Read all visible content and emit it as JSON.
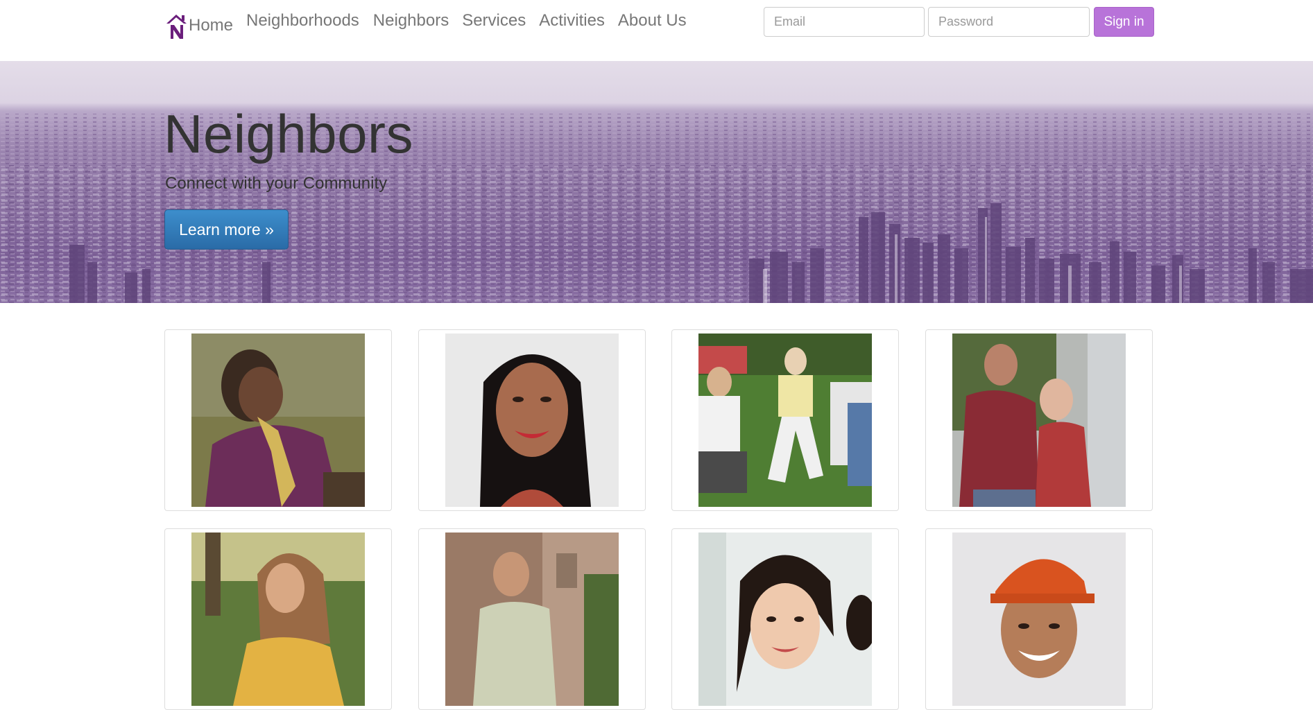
{
  "brand": {
    "label": "Home",
    "logo_icon": "house-n-logo-icon",
    "logo_color": "#6b1f7c"
  },
  "nav": {
    "items": [
      {
        "label": "Neighborhoods"
      },
      {
        "label": "Neighbors"
      },
      {
        "label": "Services"
      },
      {
        "label": "Activities"
      },
      {
        "label": "About Us"
      }
    ]
  },
  "login": {
    "email_placeholder": "Email",
    "password_placeholder": "Password",
    "signin_label": "Sign in",
    "signin_color": "#b873d9"
  },
  "hero": {
    "title": "Neighbors",
    "subtitle": "Connect with your Community",
    "button_label": "Learn more »",
    "tint_color": "#8c73a3"
  },
  "gallery": {
    "photos": [
      {
        "description_icon": "woman-purple-sweater-photo"
      },
      {
        "description_icon": "smiling-woman-portrait-photo"
      },
      {
        "description_icon": "backyard-party-photo"
      },
      {
        "description_icon": "couple-on-porch-photo"
      },
      {
        "description_icon": "woman-yellow-cardigan-photo"
      },
      {
        "description_icon": "man-outdoor-gathering-photo"
      },
      {
        "description_icon": "young-woman-smiling-photo"
      },
      {
        "description_icon": "man-orange-cap-photo"
      }
    ]
  }
}
